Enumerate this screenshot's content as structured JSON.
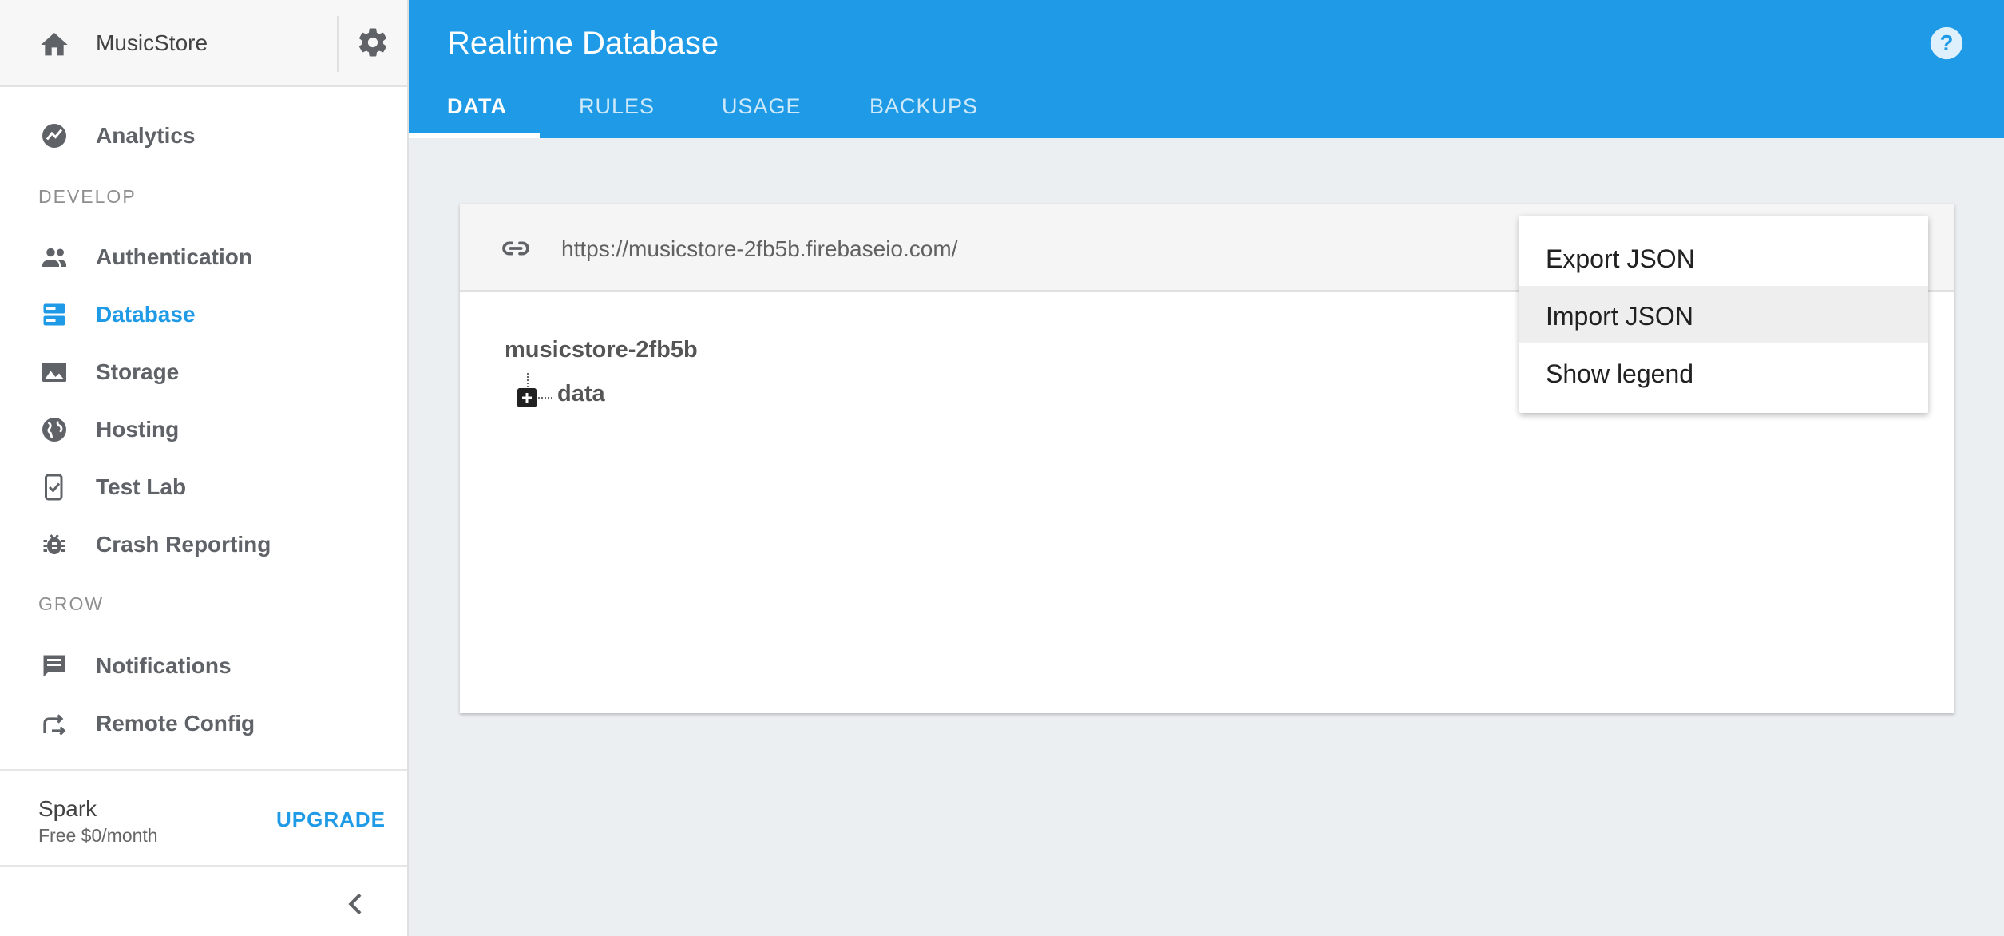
{
  "sidebar": {
    "project_name": "MusicStore",
    "items": {
      "analytics": "Analytics",
      "authentication": "Authentication",
      "database": "Database",
      "storage": "Storage",
      "hosting": "Hosting",
      "test_lab": "Test Lab",
      "crash_reporting": "Crash Reporting",
      "notifications": "Notifications",
      "remote_config": "Remote Config"
    },
    "sections": {
      "develop": "DEVELOP",
      "grow": "GROW"
    },
    "active_item": "database",
    "plan": {
      "name": "Spark",
      "price": "Free $0/month",
      "upgrade_label": "UPGRADE"
    }
  },
  "header": {
    "title": "Realtime Database",
    "tabs": [
      "DATA",
      "RULES",
      "USAGE",
      "BACKUPS"
    ],
    "active_tab": "DATA"
  },
  "database": {
    "url": "https://musicstore-2fb5b.firebaseio.com/",
    "root": "musicstore-2fb5b",
    "children": [
      "data"
    ]
  },
  "menu": {
    "items": [
      "Export JSON",
      "Import JSON",
      "Show legend"
    ],
    "highlighted": "Import JSON"
  },
  "colors": {
    "brand": "#1e9ae6",
    "background": "#eceff1",
    "icon": "#5f6368"
  }
}
